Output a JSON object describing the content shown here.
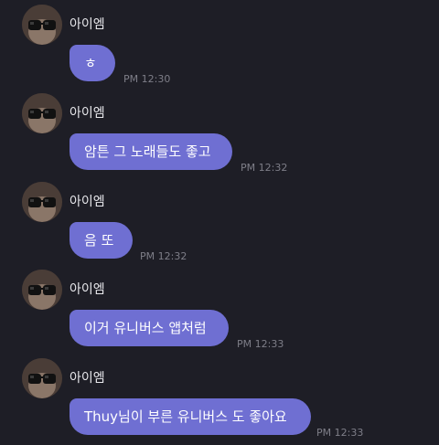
{
  "chat": {
    "messages": [
      {
        "avatar_icon": "profile-photo-sunglasses",
        "sender": "아이엠",
        "text": "ㅎ",
        "time": "PM 12:30"
      },
      {
        "avatar_icon": "profile-photo-sunglasses",
        "sender": "아이엠",
        "text": "암튼 그 노래들도 좋고",
        "time": "PM 12:32"
      },
      {
        "avatar_icon": "profile-photo-sunglasses",
        "sender": "아이엠",
        "text": "음 또",
        "time": "PM 12:32"
      },
      {
        "avatar_icon": "profile-photo-sunglasses",
        "sender": "아이엠",
        "text": "이거 유니버스 앱처럼",
        "time": "PM 12:33"
      },
      {
        "avatar_icon": "profile-photo-sunglasses",
        "sender": "아이엠",
        "text": "Thuy님이 부른 유니버스 도 좋아요",
        "time": "PM 12:33"
      }
    ],
    "colors": {
      "background": "#1e1e26",
      "bubble": "#6f6fd2",
      "bubble_text": "#ffffff",
      "sender_text": "#e8e8ec",
      "time_text": "#7e7e88"
    }
  }
}
